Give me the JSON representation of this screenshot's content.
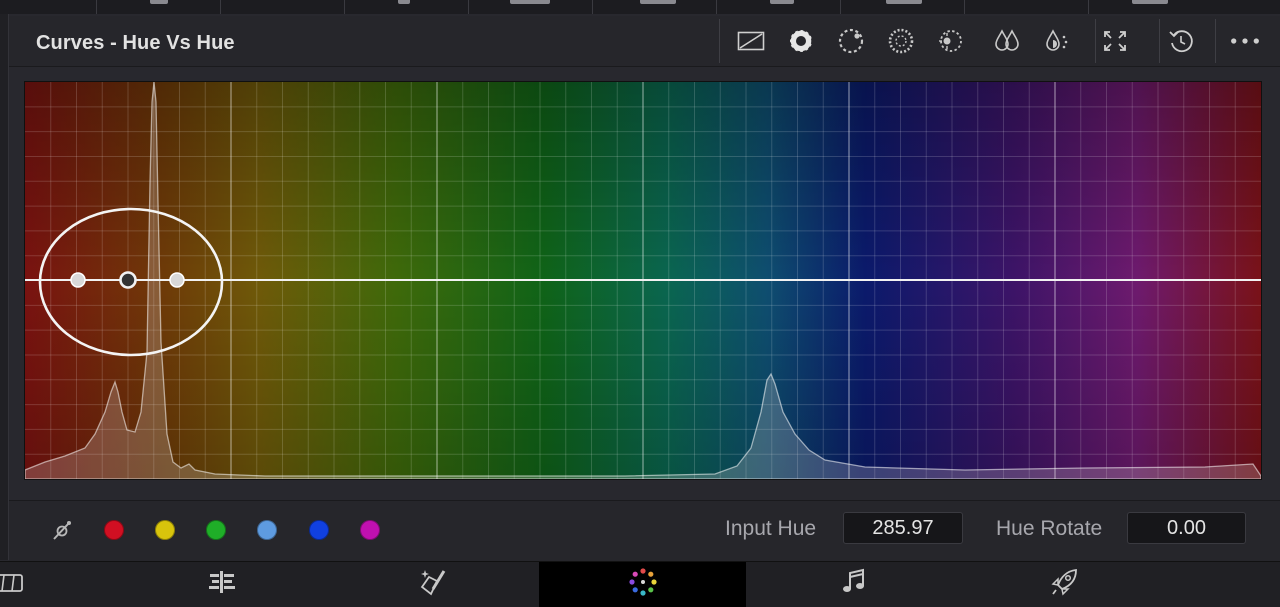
{
  "panel": {
    "title": "Curves - Hue Vs Hue"
  },
  "toolbar": {
    "icons": [
      "curve-view-icon",
      "custom-curves-icon",
      "hue-vs-hue-icon",
      "hue-vs-sat-icon",
      "hue-vs-lum-icon",
      "lum-vs-sat-icon",
      "sat-vs-sat-icon",
      "expand-icon",
      "reset-icon",
      "more-options-icon"
    ]
  },
  "graph": {
    "curve_color": "#ffffff",
    "control_points": 3,
    "gradient_colors": [
      "#7a1210",
      "#6f4c09",
      "#3f6a0a",
      "#0f6418",
      "#0a6650",
      "#0e4e70",
      "#0b1a6c",
      "#3d1468",
      "#6e1a6e",
      "#7a1218"
    ]
  },
  "qualifier": {
    "picker_icon": "hue-picker-icon",
    "swatches": [
      {
        "name": "red",
        "color": "#d10f22"
      },
      {
        "name": "yellow",
        "color": "#d8c40c"
      },
      {
        "name": "green",
        "color": "#1fae28"
      },
      {
        "name": "cyan",
        "color": "#5e9be0"
      },
      {
        "name": "blue",
        "color": "#1040e0"
      },
      {
        "name": "magenta",
        "color": "#c010b0"
      }
    ],
    "input_hue_label": "Input Hue",
    "input_hue_value": "285.97",
    "hue_rotate_label": "Hue Rotate",
    "hue_rotate_value": "0.00"
  },
  "pages": {
    "items": [
      "media-page-icon",
      "edit-page-icon",
      "fusion-page-icon",
      "color-page-icon",
      "fairlight-page-icon",
      "deliver-page-icon"
    ],
    "active": "color-page-icon"
  }
}
